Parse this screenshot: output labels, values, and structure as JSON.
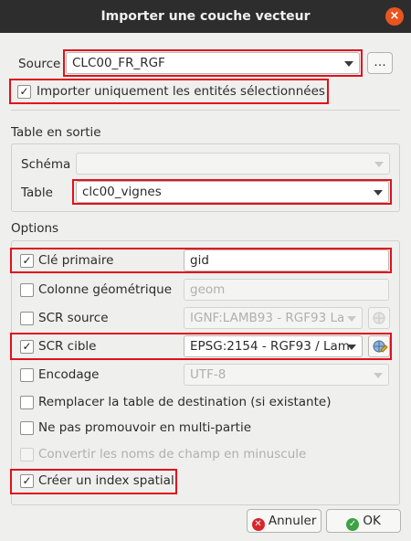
{
  "window": {
    "title": "Importer une couche vecteur",
    "close_symbol": "×"
  },
  "source": {
    "label": "Source",
    "value": "CLC00_FR_RGF",
    "browse_label": "…"
  },
  "import_selected": {
    "label": "Importer uniquement les entités sélectionnées",
    "checked": true
  },
  "output_table": {
    "section_title": "Table en sortie",
    "schema_label": "Schéma",
    "schema_value": "",
    "table_label": "Table",
    "table_value": "clc00_vignes"
  },
  "options": {
    "section_title": "Options",
    "primary_key": {
      "label": "Clé primaire",
      "checked": true,
      "value": "gid"
    },
    "geom_column": {
      "label": "Colonne géométrique",
      "checked": false,
      "value": "geom"
    },
    "source_crs": {
      "label": "SCR source",
      "checked": false,
      "value": "IGNF:LAMB93 - RGF93 La"
    },
    "target_crs": {
      "label": "SCR cible",
      "checked": true,
      "value": "EPSG:2154 - RGF93 / Lam"
    },
    "encoding": {
      "label": "Encodage",
      "checked": false,
      "value": "UTF-8"
    },
    "replace_table": {
      "label": "Remplacer la table de destination (si existante)",
      "checked": false
    },
    "no_multipart": {
      "label": "Ne pas promouvoir en multi-partie",
      "checked": false
    },
    "lowercase_fields": {
      "label": "Convertir les noms de champ en minuscule",
      "checked": false
    },
    "spatial_index": {
      "label": "Créer un index spatial",
      "checked": true
    }
  },
  "buttons": {
    "cancel_label": "Annuler",
    "ok_label": "OK"
  },
  "check_mark": "✓",
  "colors": {
    "highlight": "#e0111b",
    "titlebar": "#2d2d2d",
    "close": "#e9541f",
    "cancel_icon": "#d8262b",
    "ok_icon": "#3fa144"
  }
}
